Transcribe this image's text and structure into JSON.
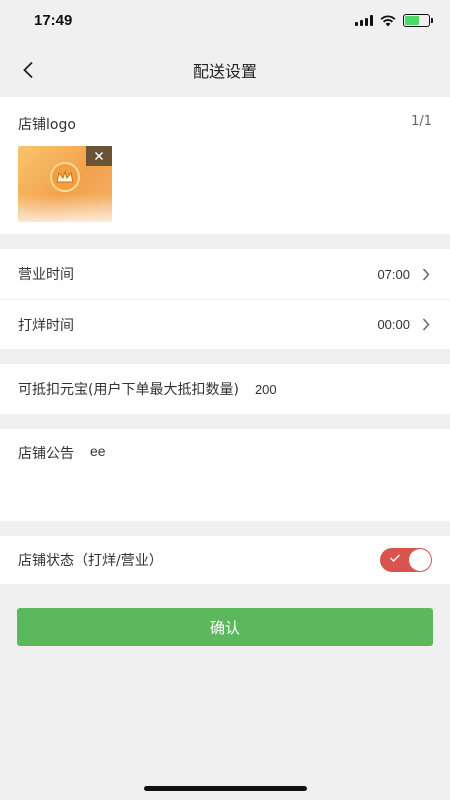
{
  "status_bar": {
    "time": "17:49"
  },
  "nav": {
    "title": "配送设置"
  },
  "logo": {
    "label": "店铺logo",
    "count": "1/1"
  },
  "business_hours": {
    "label": "营业时间",
    "value": "07:00"
  },
  "closing_time": {
    "label": "打烊时间",
    "value": "00:00"
  },
  "coins": {
    "label": "可抵扣元宝(用户下单最大抵扣数量)",
    "value": "200"
  },
  "notice": {
    "label": "店铺公告",
    "value": "ee"
  },
  "store_status": {
    "label": "店铺状态（打烊/营业）",
    "on": true
  },
  "confirm": {
    "label": "确认"
  },
  "colors": {
    "accent_green": "#5cb85c",
    "toggle_red": "#d9534f"
  }
}
